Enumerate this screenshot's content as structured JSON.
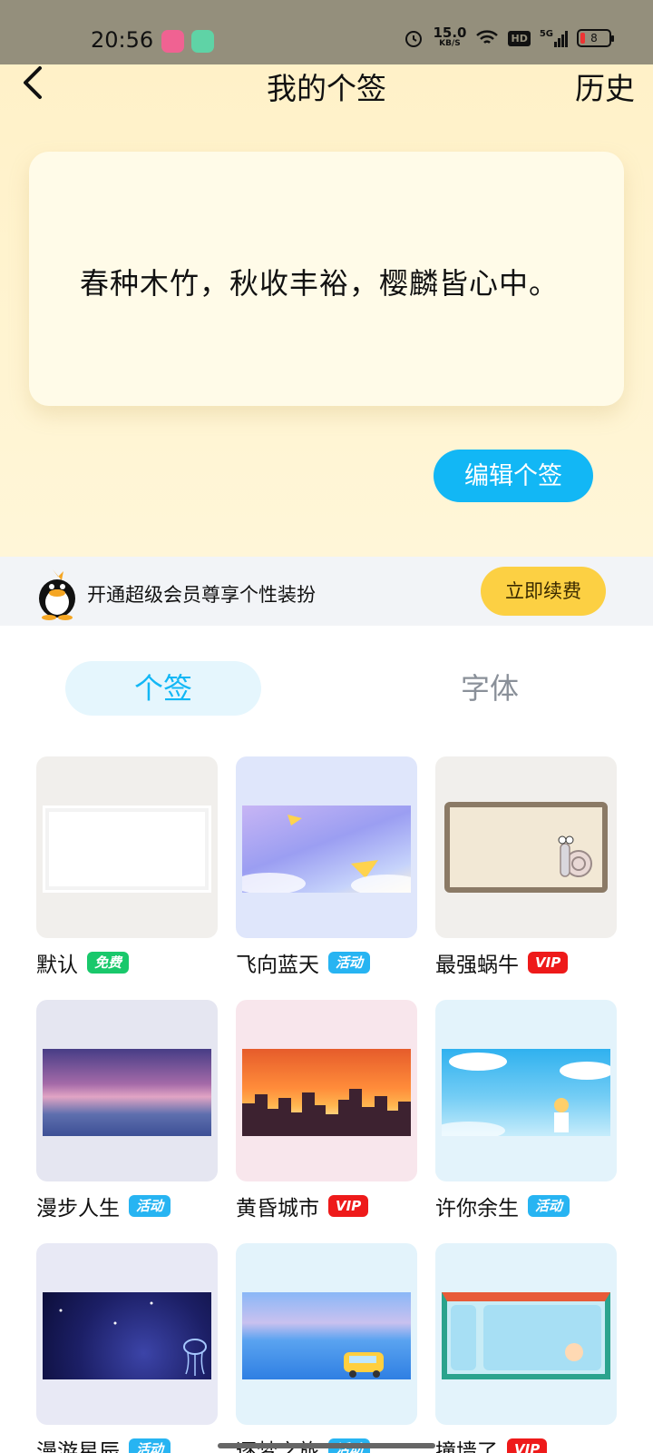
{
  "status": {
    "time": "20:56",
    "speed_top": "15.0",
    "speed_unit": "KB/S",
    "network": "5G",
    "battery": "8"
  },
  "header": {
    "title": "我的个签",
    "history": "历史"
  },
  "signature": {
    "text": "春种木竹，秋收丰裕，樱麟皆心中。",
    "edit_label": "编辑个签"
  },
  "vip_banner": {
    "text": "开通超级会员尊享个性装扮",
    "button": "立即续费"
  },
  "tabs": [
    {
      "label": "个签"
    },
    {
      "label": "字体"
    }
  ],
  "styles": [
    {
      "name": "默认",
      "badge": "免费",
      "badge_type": "free"
    },
    {
      "name": "飞向蓝天",
      "badge": "活动",
      "badge_type": "event"
    },
    {
      "name": "最强蜗牛",
      "badge": "VIP",
      "badge_type": "vip"
    },
    {
      "name": "漫步人生",
      "badge": "活动",
      "badge_type": "event"
    },
    {
      "name": "黄昏城市",
      "badge": "VIP",
      "badge_type": "vip"
    },
    {
      "name": "许你余生",
      "badge": "活动",
      "badge_type": "event"
    },
    {
      "name": "漫游星辰",
      "badge": "活动",
      "badge_type": "event"
    },
    {
      "name": "逐梦之旅",
      "badge": "活动",
      "badge_type": "event"
    },
    {
      "name": "撞墙了",
      "badge": "VIP",
      "badge_type": "vip"
    }
  ]
}
